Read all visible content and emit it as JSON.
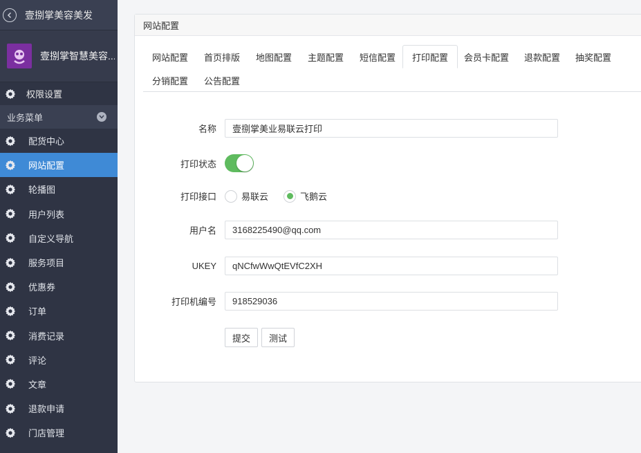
{
  "app": {
    "title": "壹捌掌美容美发",
    "brand_name": "壹捌掌智慧美容..."
  },
  "sidebar": {
    "permission_label": "权限设置",
    "section_label": "业务菜单",
    "items": [
      {
        "label": "配货中心",
        "icon": "gear-icon"
      },
      {
        "label": "网站配置",
        "icon": "gear-icon",
        "active": true
      },
      {
        "label": "轮播图",
        "icon": "gear-icon"
      },
      {
        "label": "用户列表",
        "icon": "gear-icon"
      },
      {
        "label": "自定义导航",
        "icon": "gear-icon"
      },
      {
        "label": "服务项目",
        "icon": "gear-icon"
      },
      {
        "label": "优惠券",
        "icon": "gear-icon"
      },
      {
        "label": "订单",
        "icon": "gear-icon"
      },
      {
        "label": "消费记录",
        "icon": "gear-icon"
      },
      {
        "label": "评论",
        "icon": "gear-icon"
      },
      {
        "label": "文章",
        "icon": "gear-icon"
      },
      {
        "label": "退款申请",
        "icon": "gear-icon"
      },
      {
        "label": "门店管理",
        "icon": "gear-icon"
      }
    ]
  },
  "panel": {
    "title": "网站配置",
    "tabs": [
      "网站配置",
      "首页排版",
      "地图配置",
      "主题配置",
      "短信配置",
      "打印配置",
      "会员卡配置",
      "退款配置",
      "抽奖配置",
      "分销配置",
      "公告配置"
    ],
    "active_tab": "打印配置"
  },
  "form": {
    "name_label": "名称",
    "name_value": "壹捌掌美业易联云打印",
    "status_label": "打印状态",
    "status_on": true,
    "interface_label": "打印接口",
    "interface_options": [
      "易联云",
      "飞鹅云"
    ],
    "interface_selected": "飞鹅云",
    "username_label": "用户名",
    "username_value": "3168225490@qq.com",
    "ukey_label": "UKEY",
    "ukey_value": "qNCfwWwQtEVfC2XH",
    "printer_label": "打印机编号",
    "printer_value": "918529036",
    "submit_label": "提交",
    "test_label": "测试"
  },
  "colors": {
    "sidebar_bg": "#2f3444",
    "active_bg": "#3f8ad6",
    "toggle_on": "#5fbb5f"
  }
}
